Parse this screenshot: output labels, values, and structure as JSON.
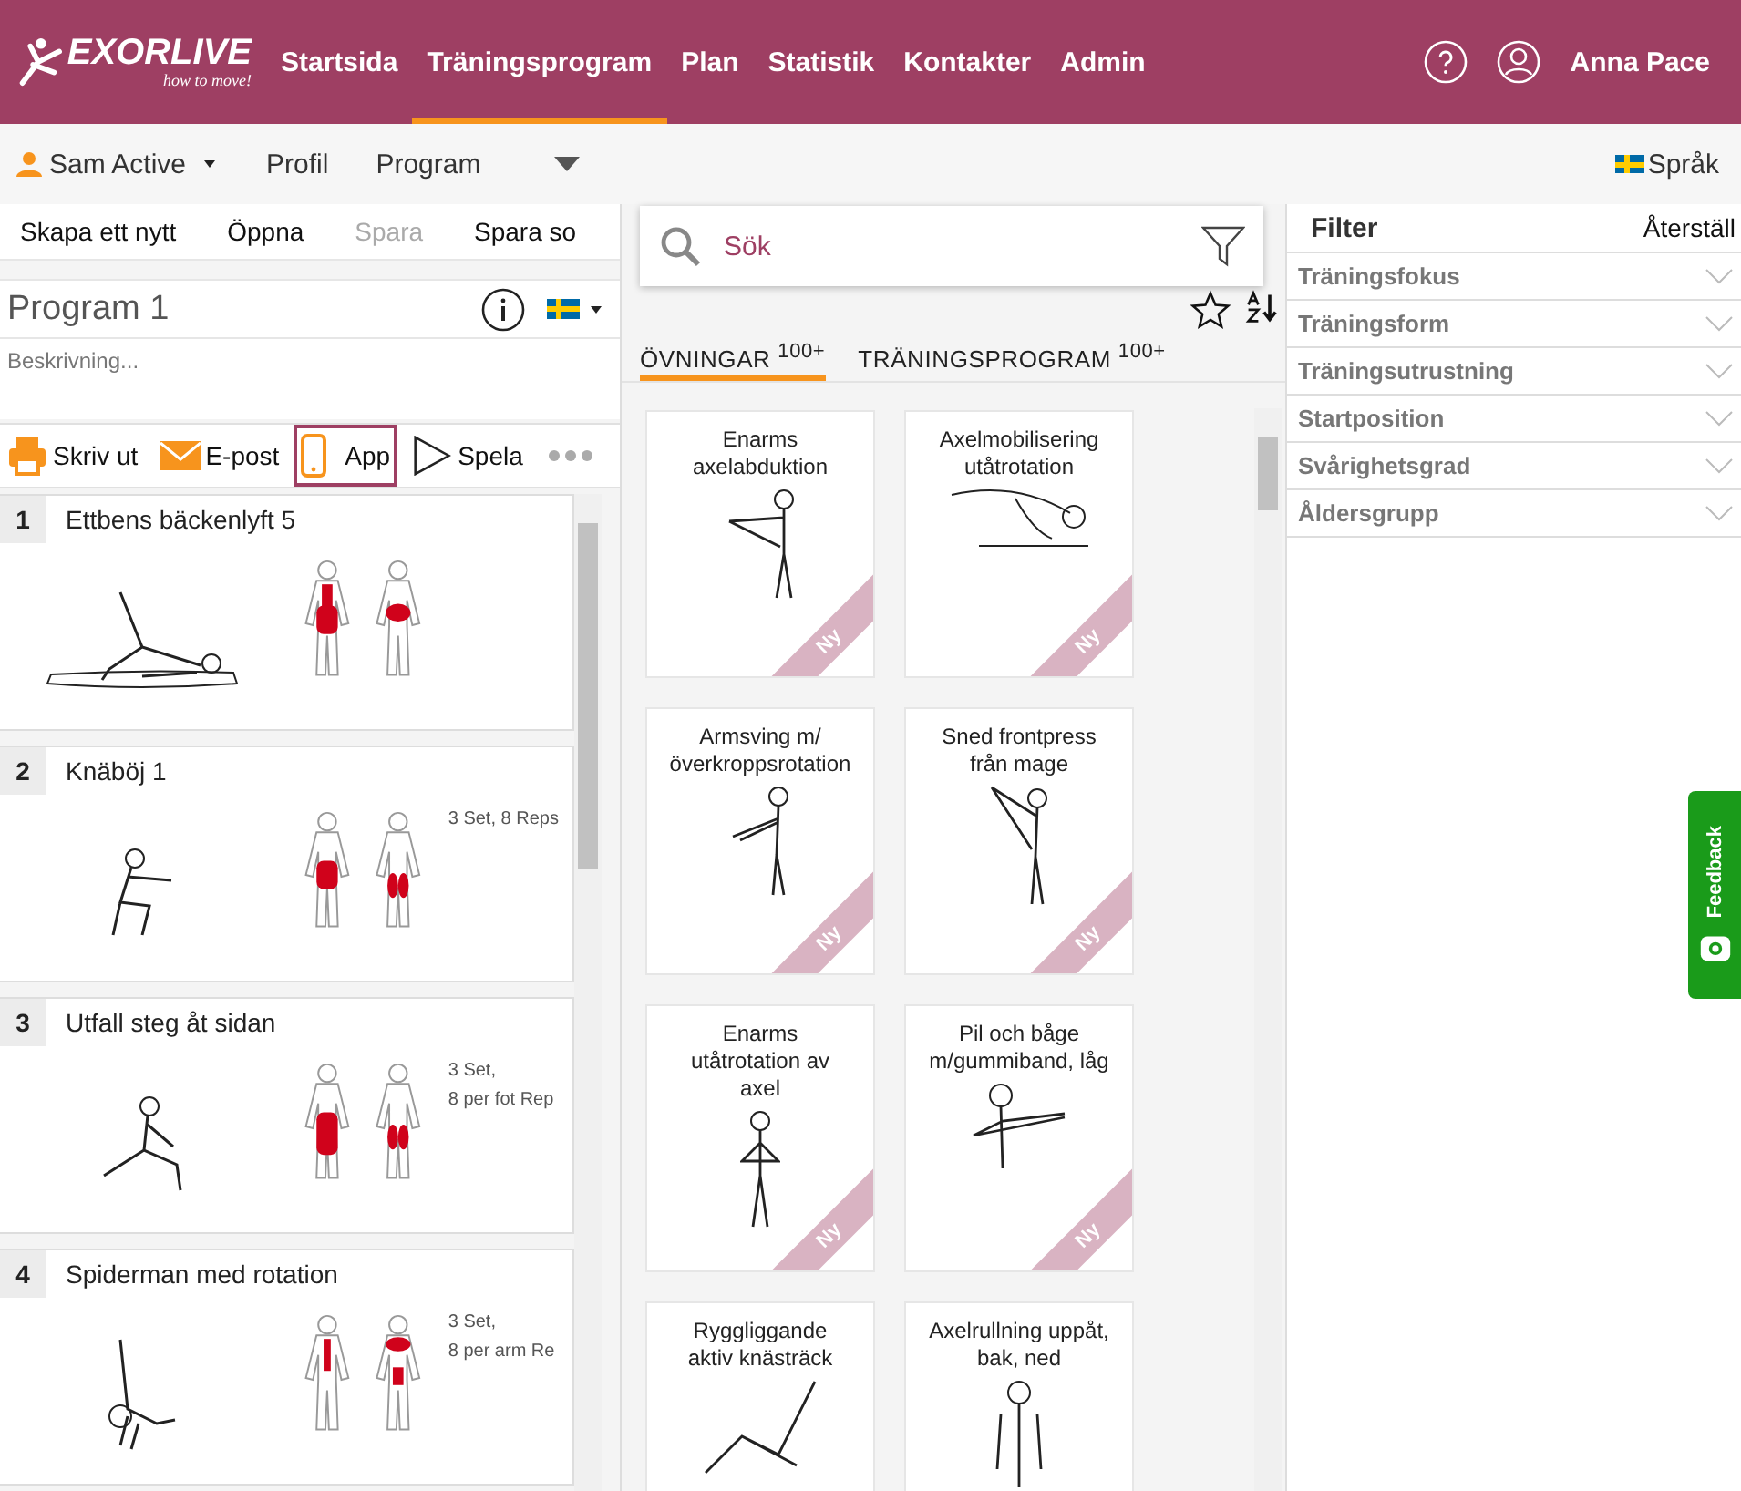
{
  "header": {
    "logo": {
      "brand": "EXORLIVE",
      "tagline": "how to move!"
    },
    "nav": [
      {
        "label": "Startsida",
        "selected": false
      },
      {
        "label": "Träningsprogram",
        "selected": true
      },
      {
        "label": "Plan",
        "selected": false
      },
      {
        "label": "Statistik",
        "selected": false
      },
      {
        "label": "Kontakter",
        "selected": false
      },
      {
        "label": "Admin",
        "selected": false
      }
    ],
    "user": "Anna Pace"
  },
  "subbar": {
    "client": "Sam Active",
    "links": [
      "Profil",
      "Program"
    ],
    "language": "Språk"
  },
  "program_toolbar": [
    {
      "label": "Skapa ett nytt",
      "disabled": false
    },
    {
      "label": "Öppna",
      "disabled": false
    },
    {
      "label": "Spara",
      "disabled": true
    },
    {
      "label": "Spara so",
      "disabled": false
    }
  ],
  "program": {
    "title": "Program 1",
    "description_placeholder": "Beskrivning..."
  },
  "actions": [
    {
      "kind": "print",
      "label": "Skriv ut",
      "selected": false
    },
    {
      "kind": "email",
      "label": "E-post",
      "selected": false
    },
    {
      "kind": "app",
      "label": "App",
      "selected": true
    },
    {
      "kind": "play",
      "label": "Spela",
      "selected": false
    }
  ],
  "program_items": [
    {
      "number": "1",
      "title": "Ettbens bäckenlyft 5"
    },
    {
      "number": "2",
      "title": "Knäböj 1",
      "dosage": [
        "3 Set, 8 Reps"
      ]
    },
    {
      "number": "3",
      "title": "Utfall steg åt sidan",
      "dosage": [
        "3 Set,",
        "8 per fot Rep"
      ]
    },
    {
      "number": "4",
      "title": "Spiderman med rotation",
      "dosage": [
        "3 Set,",
        "8 per arm Re"
      ]
    }
  ],
  "search": {
    "placeholder": "Sök"
  },
  "tabs": [
    {
      "label": "ÖVNINGAR",
      "count": "100+",
      "selected": true
    },
    {
      "label": "TRÄNINGSPROGRAM",
      "count": "100+",
      "selected": false
    }
  ],
  "exercises": [
    {
      "title": "Enarms axelabduktion",
      "badge": "Ny"
    },
    {
      "title": "Axelmobilisering utåtrotation",
      "badge": "Ny"
    },
    {
      "title": "Armsving m/ överkroppsrotation",
      "badge": "Ny"
    },
    {
      "title": "Sned frontpress från mage",
      "badge": "Ny"
    },
    {
      "title": "Enarms utåtrotation av axel",
      "badge": "Ny"
    },
    {
      "title": "Pil och båge m/gummiband, låg",
      "badge": "Ny"
    },
    {
      "title": "Ryggliggande aktiv knästräck"
    },
    {
      "title": "Axelrullning uppåt, bak, ned"
    }
  ],
  "filter": {
    "title": "Filter",
    "reset": "Återställ",
    "groups": [
      {
        "label": "Träningsfokus",
        "expanded": false
      },
      {
        "label": "Träningsform",
        "expanded": false
      },
      {
        "label": "Träningsutrustning",
        "expanded": false
      },
      {
        "label": "Startposition",
        "expanded": false
      },
      {
        "label": "Svårighetsgrad",
        "expanded": false
      },
      {
        "label": "Åldersgrupp",
        "expanded": false
      }
    ]
  },
  "feedback": "Feedback"
}
